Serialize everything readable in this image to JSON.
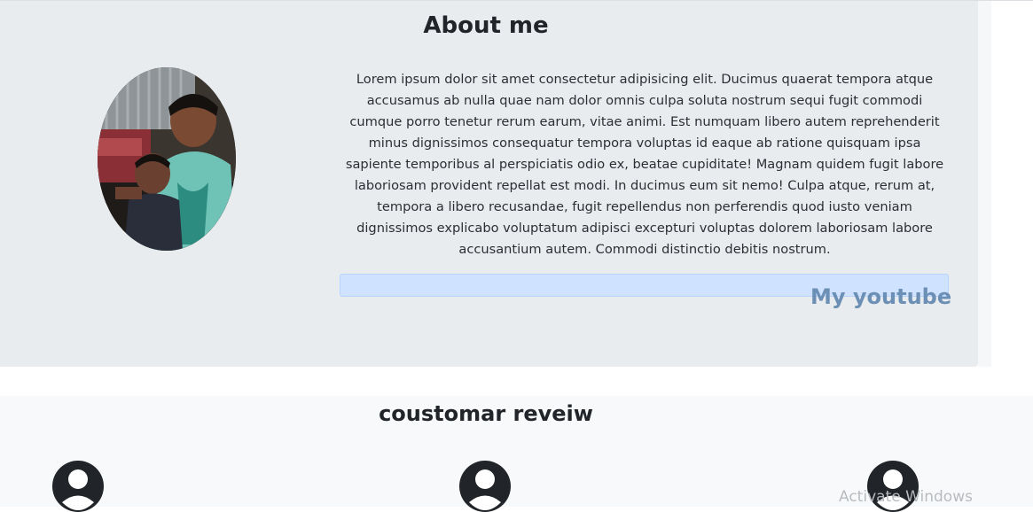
{
  "about": {
    "title": "About me",
    "paragraph": "Lorem ipsum dolor sit amet consectetur adipisicing elit. Ducimus quaerat tempora atque accusamus ab nulla quae nam dolor omnis culpa soluta nostrum sequi fugit commodi cumque porro tenetur rerum earum, vitae animi. Est numquam libero autem reprehenderit minus dignissimos consequatur tempora voluptas id eaque ab ratione quisquam ipsa sapiente temporibus al perspiciatis odio ex, beatae cupiditate! Magnam quidem fugit labore laboriosam provident repellat est modi. In ducimus eum sit nemo! Culpa atque, rerum at, tempora a libero recusandae, fugit repellendus non perferendis quod iusto veniam dignissimos explicabo voluptatum adipisci excepturi voluptas dolorem laboriosam labore accusantium autem. Commodi distinctio debitis nostrum.",
    "youtube_label": "My youtube"
  },
  "reviews": {
    "title": "coustomar reveiw",
    "user_icons": [
      "user-avatar-icon",
      "user-avatar-icon",
      "user-avatar-icon"
    ]
  },
  "system": {
    "watermark": "Activate Windows"
  },
  "colors": {
    "about_bg": "#e9ecef",
    "review_bg": "#f8f9fa",
    "link": "#6c8fb6",
    "youtube_bar": "#cfe2ff"
  }
}
